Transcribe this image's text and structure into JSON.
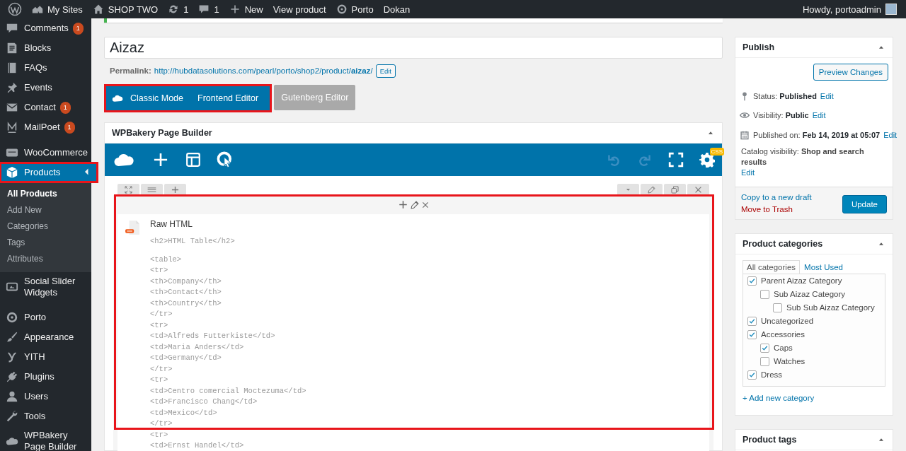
{
  "admin_bar": {
    "items": [
      {
        "label": "My Sites"
      },
      {
        "label": "SHOP TWO"
      },
      {
        "label": "1"
      },
      {
        "label": "1"
      },
      {
        "label": "New"
      },
      {
        "label": "View product"
      },
      {
        "label": "Porto"
      },
      {
        "label": "Dokan"
      }
    ],
    "account": "Howdy, portoadmin"
  },
  "sidebar": {
    "sections": [
      {
        "items": [
          {
            "label": "Comments",
            "badge": "1",
            "selected": false,
            "highlighted": false
          },
          {
            "label": "Blocks",
            "selected": false,
            "highlighted": false
          },
          {
            "label": "FAQs",
            "selected": false,
            "highlighted": false
          },
          {
            "label": "Events",
            "selected": false,
            "highlighted": false
          },
          {
            "label": "Contact",
            "badge": "1",
            "selected": false,
            "highlighted": false
          },
          {
            "label": "MailPoet",
            "badge": "1",
            "selected": false,
            "highlighted": false
          }
        ]
      },
      {
        "items": [
          {
            "label": "WooCommerce",
            "selected": false,
            "highlighted": false
          },
          {
            "label": "Products",
            "selected": true,
            "highlighted": true,
            "children": [
              {
                "label": "All Products",
                "selected": true
              },
              {
                "label": "Add New",
                "selected": false
              },
              {
                "label": "Categories",
                "selected": false
              },
              {
                "label": "Tags",
                "selected": false
              },
              {
                "label": "Attributes",
                "selected": false
              }
            ]
          },
          {
            "label": "Social Slider Widgets",
            "selected": false,
            "highlighted": false
          }
        ]
      },
      {
        "items": [
          {
            "label": "Porto",
            "selected": false,
            "highlighted": false
          },
          {
            "label": "Appearance",
            "selected": false,
            "highlighted": false
          },
          {
            "label": "YITH",
            "selected": false,
            "highlighted": false
          },
          {
            "label": "Plugins",
            "selected": false,
            "highlighted": false
          },
          {
            "label": "Users",
            "selected": false,
            "highlighted": false
          },
          {
            "label": "Tools",
            "selected": false,
            "highlighted": false
          },
          {
            "label": "WPBakery Page Builder",
            "selected": false,
            "highlighted": false
          }
        ]
      }
    ]
  },
  "editor": {
    "title_field": {
      "value": "Aizaz"
    },
    "permalink": {
      "label": "Permalink:",
      "url": "http://hubdatasolutions.com/pearl/porto/shop2/product/**aizaz**/",
      "button": "Edit"
    },
    "mode_group": {
      "highlighted": true,
      "buttons": [
        {
          "label": "Classic Mode"
        },
        {
          "label": "Frontend Editor"
        }
      ]
    },
    "gutenberg_button": {
      "label": "Gutenberg Editor",
      "disabled": true
    },
    "page_builder": {
      "title": "WPBakery Page Builder",
      "css_badge": "CSS",
      "element": {
        "title": "Raw HTML",
        "highlighted": true,
        "heading_line": "<h2>HTML Table</h2>",
        "code_lines": [
          "<table>",
          "<tr>",
          "<th>Company</th>",
          "<th>Contact</th>",
          "<th>Country</th>",
          "</tr>",
          "<tr>",
          "<td>Alfreds Futterkiste</td>",
          "<td>Maria Anders</td>",
          "<td>Germany</td>",
          "</tr>",
          "<tr>",
          "<td>Centro comercial Moctezuma</td>",
          "<td>Francisco Chang</td>",
          "<td>Mexico</td>",
          "</tr>",
          "<tr>",
          "<td>Ernst Handel</td>"
        ]
      }
    }
  },
  "publish": {
    "title": "Publish",
    "preview_button": "Preview Changes",
    "rows": [
      {
        "label": "Status:",
        "value": "Published",
        "link": "Edit"
      },
      {
        "label": "Visibility:",
        "value": "Public",
        "link": "Edit"
      },
      {
        "label": "Published on:",
        "value": "Feb 14, 2019 at 05:07",
        "link": "Edit"
      }
    ],
    "catalog": {
      "label": "Catalog visibility:",
      "value": "Shop and search results",
      "link": "Edit"
    },
    "copy_link": "Copy to a new draft",
    "trash_link": "Move to Trash",
    "update_button": "Update"
  },
  "product_categories": {
    "title": "Product categories",
    "tabs": [
      {
        "label": "All categories",
        "selected": true
      },
      {
        "label": "Most Used",
        "selected": false
      }
    ],
    "categories": [
      {
        "label": "Parent Aizaz Category",
        "checked": true,
        "children": [
          {
            "label": "Sub Aizaz Category",
            "checked": false,
            "children": [
              {
                "label": "Sub Sub Aizaz Category",
                "checked": false
              }
            ]
          }
        ]
      },
      {
        "label": "Uncategorized",
        "checked": true
      },
      {
        "label": "Accessories",
        "checked": true,
        "children": [
          {
            "label": "Caps",
            "checked": true
          },
          {
            "label": "Watches",
            "checked": false
          }
        ]
      },
      {
        "label": "Dress",
        "checked": true
      }
    ],
    "add_link": "+ Add new category"
  },
  "product_tags": {
    "title": "Product tags"
  }
}
